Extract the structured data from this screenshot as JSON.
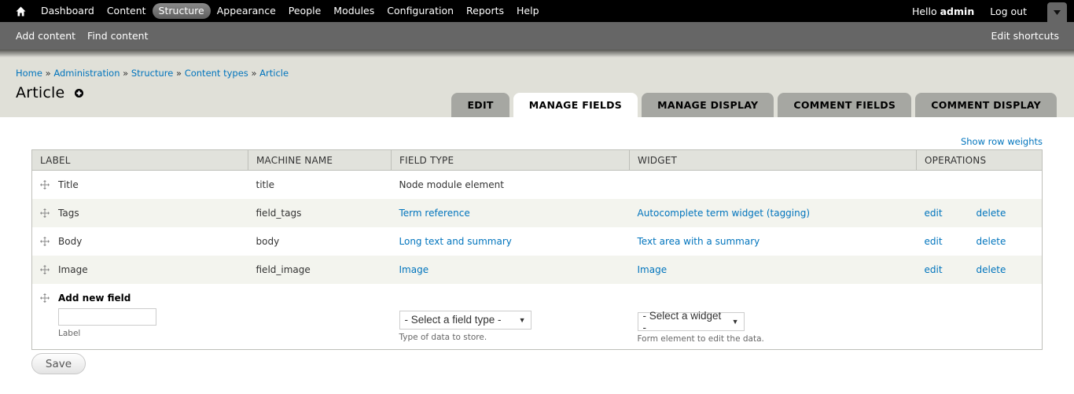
{
  "toolbar": {
    "home_icon": "home-icon",
    "menu": [
      {
        "label": "Dashboard",
        "active": false
      },
      {
        "label": "Content",
        "active": false
      },
      {
        "label": "Structure",
        "active": true
      },
      {
        "label": "Appearance",
        "active": false
      },
      {
        "label": "People",
        "active": false
      },
      {
        "label": "Modules",
        "active": false
      },
      {
        "label": "Configuration",
        "active": false
      },
      {
        "label": "Reports",
        "active": false
      },
      {
        "label": "Help",
        "active": false
      }
    ],
    "hello": "Hello",
    "username": "admin",
    "logout": "Log out",
    "drawer_icon": "triangle-down-icon"
  },
  "shortcuts": {
    "items": [
      "Add content",
      "Find content"
    ],
    "edit_shortcuts": "Edit shortcuts"
  },
  "breadcrumb": [
    "Home",
    "Administration",
    "Structure",
    "Content types",
    "Article"
  ],
  "breadcrumb_separator": "»",
  "page_title": "Article",
  "tabs": [
    {
      "label": "EDIT",
      "active": false
    },
    {
      "label": "MANAGE FIELDS",
      "active": true
    },
    {
      "label": "MANAGE DISPLAY",
      "active": false
    },
    {
      "label": "COMMENT FIELDS",
      "active": false
    },
    {
      "label": "COMMENT DISPLAY",
      "active": false
    }
  ],
  "show_row_weights": "Show row weights",
  "table": {
    "headers": [
      "LABEL",
      "MACHINE NAME",
      "FIELD TYPE",
      "WIDGET",
      "OPERATIONS"
    ],
    "rows": [
      {
        "label": "Title",
        "machine_name": "title",
        "field_type": "Node module element",
        "field_type_link": false,
        "widget": "",
        "edit": "",
        "delete": ""
      },
      {
        "label": "Tags",
        "machine_name": "field_tags",
        "field_type": "Term reference",
        "field_type_link": true,
        "widget": "Autocomplete term widget (tagging)",
        "edit": "edit",
        "delete": "delete"
      },
      {
        "label": "Body",
        "machine_name": "body",
        "field_type": "Long text and summary",
        "field_type_link": true,
        "widget": "Text area with a summary",
        "edit": "edit",
        "delete": "delete"
      },
      {
        "label": "Image",
        "machine_name": "field_image",
        "field_type": "Image",
        "field_type_link": true,
        "widget": "Image",
        "edit": "edit",
        "delete": "delete"
      }
    ],
    "add_new": {
      "title": "Add new field",
      "label_value": "",
      "label_desc": "Label",
      "field_type_select": "- Select a field type -",
      "field_type_desc": "Type of data to store.",
      "widget_select": "- Select a widget -",
      "widget_desc": "Form element to edit the data."
    }
  },
  "save_label": "Save",
  "colors": {
    "link": "#0074bd",
    "toolbar": "#000000",
    "shortcuts_bar": "#666666",
    "branding_bg": "#e0e0d8",
    "tab_inactive": "#a6a7a2"
  }
}
